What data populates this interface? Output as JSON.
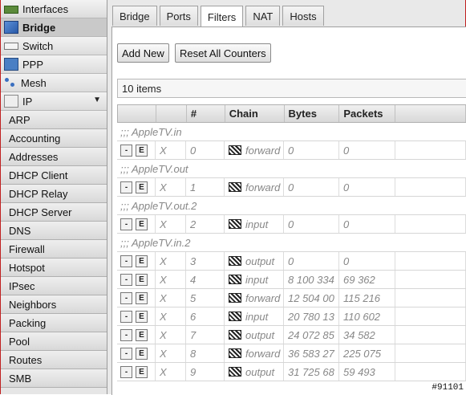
{
  "sidebar": {
    "items": [
      {
        "label": "Interfaces",
        "icon": "interfaces-icon"
      },
      {
        "label": "Bridge",
        "icon": "bridge-icon",
        "active": true
      },
      {
        "label": "Switch",
        "icon": "switch-icon"
      },
      {
        "label": "PPP",
        "icon": "ppp-icon"
      },
      {
        "label": "Mesh",
        "icon": "mesh-icon"
      },
      {
        "label": "IP",
        "icon": "ip-icon",
        "expanded": true
      }
    ],
    "ip_submenu": [
      "ARP",
      "Accounting",
      "Addresses",
      "DHCP Client",
      "DHCP Relay",
      "DHCP Server",
      "DNS",
      "Firewall",
      "Hotspot",
      "IPsec",
      "Neighbors",
      "Packing",
      "Pool",
      "Routes",
      "SMB"
    ]
  },
  "tabs": [
    "Bridge",
    "Ports",
    "Filters",
    "NAT",
    "Hosts"
  ],
  "active_tab": "Filters",
  "toolbar": {
    "add_new": "Add New",
    "reset_counters": "Reset All Counters"
  },
  "item_count": "10 items",
  "table": {
    "columns": [
      "",
      "",
      "#",
      "Chain",
      "Bytes",
      "Packets"
    ],
    "rows": [
      {
        "comment": ";;; AppleTV.in"
      },
      {
        "flag": "X",
        "num": "0",
        "chain": "forward",
        "bytes": "0",
        "packets": "0"
      },
      {
        "comment": ";;; AppleTV.out"
      },
      {
        "flag": "X",
        "num": "1",
        "chain": "forward",
        "bytes": "0",
        "packets": "0"
      },
      {
        "comment": ";;; AppleTV.out.2"
      },
      {
        "flag": "X",
        "num": "2",
        "chain": "input",
        "bytes": "0",
        "packets": "0"
      },
      {
        "comment": ";;; AppleTV.in.2"
      },
      {
        "flag": "X",
        "num": "3",
        "chain": "output",
        "bytes": "0",
        "packets": "0"
      },
      {
        "flag": "X",
        "num": "4",
        "chain": "input",
        "bytes": "8 100 334",
        "packets": "69 362"
      },
      {
        "flag": "X",
        "num": "5",
        "chain": "forward",
        "bytes": "12 504 00",
        "packets": "115 216"
      },
      {
        "flag": "X",
        "num": "6",
        "chain": "input",
        "bytes": "20 780 13",
        "packets": "110 602"
      },
      {
        "flag": "X",
        "num": "7",
        "chain": "output",
        "bytes": "24 072 85",
        "packets": "34 582"
      },
      {
        "flag": "X",
        "num": "8",
        "chain": "forward",
        "bytes": "36 583 27",
        "packets": "225 075"
      },
      {
        "flag": "X",
        "num": "9",
        "chain": "output",
        "bytes": "31 725 68",
        "packets": "59 493"
      }
    ],
    "row_buttons": {
      "remove": "-",
      "edit": "E"
    }
  },
  "badge": "#91101"
}
